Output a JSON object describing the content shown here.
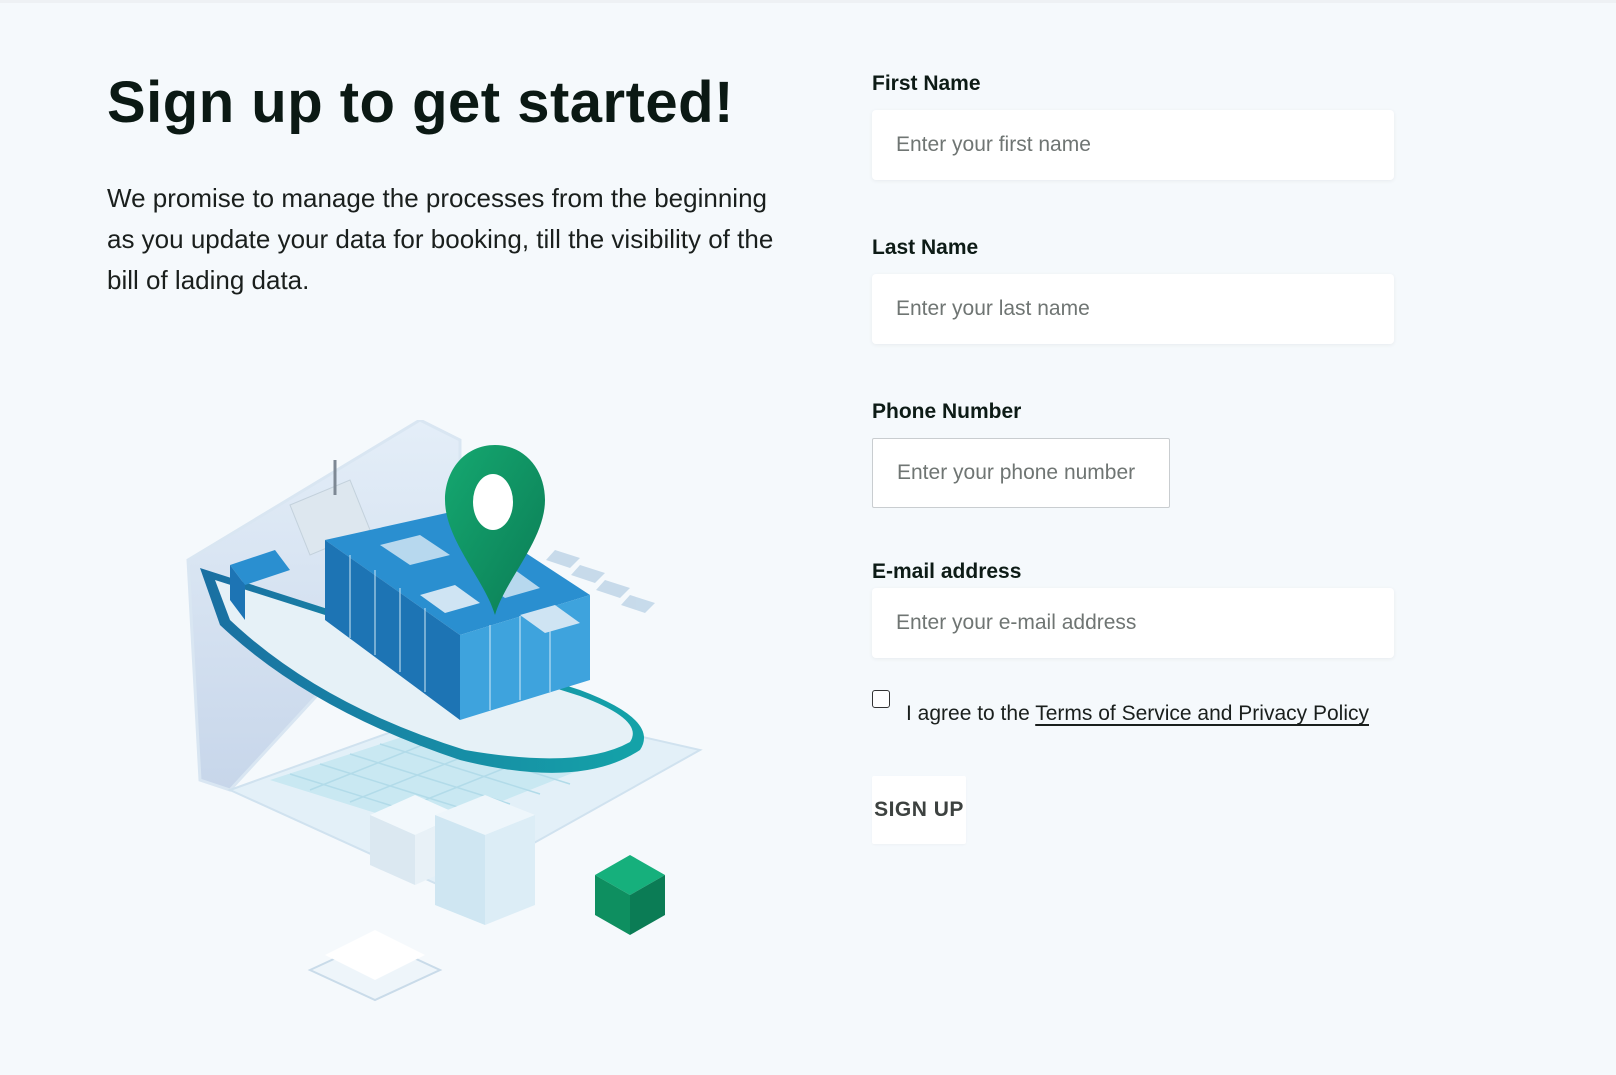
{
  "hero": {
    "title": "Sign up to get started!",
    "description": "We promise to manage the processes from the beginning as you update your data for booking, till the visibility of the bill of lading data."
  },
  "form": {
    "first_name": {
      "label": "First Name",
      "placeholder": "Enter your first name",
      "value": ""
    },
    "last_name": {
      "label": "Last Name",
      "placeholder": "Enter your last name",
      "value": ""
    },
    "phone": {
      "label": "Phone Number",
      "placeholder": "Enter your phone number",
      "value": ""
    },
    "email": {
      "label": "E-mail address",
      "placeholder": "Enter your e-mail address",
      "value": ""
    },
    "agree": {
      "checked": false,
      "prefix": "I agree to the ",
      "link_text": "Terms of Service and Privacy Policy"
    },
    "submit_label": "SIGN UP"
  },
  "colors": {
    "background": "#f5f9fc",
    "heading": "#0b1914",
    "accent_green": "#0e9466",
    "accent_blue": "#1f88c8",
    "ship_teal": "#169aa6"
  },
  "illustration": {
    "icons": [
      "laptop-icon",
      "cargo-ship-icon",
      "location-pin-icon",
      "shipping-box-icon"
    ]
  }
}
